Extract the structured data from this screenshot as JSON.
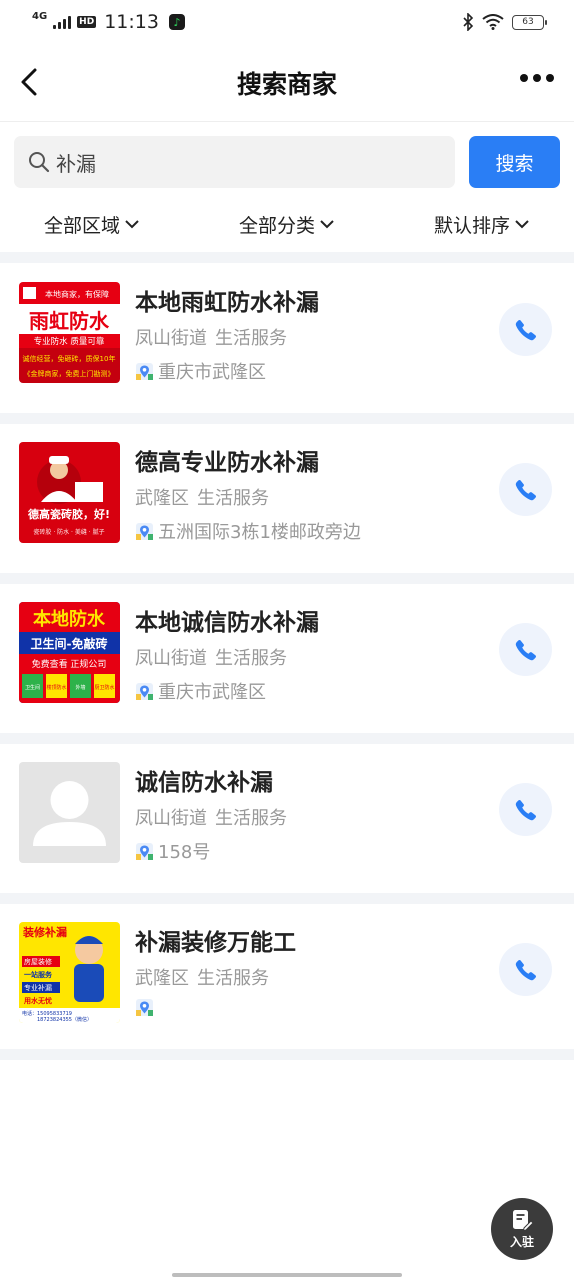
{
  "status_bar": {
    "network": "4G",
    "hd": "HD",
    "time": "11:13",
    "battery": "63"
  },
  "nav": {
    "title": "搜索商家",
    "back_icon": "back-arrow-icon",
    "more_icon": "more-dots-icon"
  },
  "search": {
    "query": "补漏",
    "button_label": "搜索"
  },
  "filters": [
    {
      "label": "全部区域"
    },
    {
      "label": "全部分类"
    },
    {
      "label": "默认排序"
    }
  ],
  "merchants": [
    {
      "name": "本地雨虹防水补漏",
      "area": "凤山街道",
      "category": "生活服务",
      "address": "重庆市武隆区",
      "thumb": {
        "line1": "本地商家，有保障",
        "title": "雨虹防水",
        "line2": "专业防水 质量可靠",
        "line3": "诚信经营，免砸砖，质保10年",
        "line4": "《金牌商家，免费上门勘测》"
      }
    },
    {
      "name": "德高专业防水补漏",
      "area": "武隆区",
      "category": "生活服务",
      "address": "五洲国际3栋1楼邮政旁边",
      "thumb": {
        "title": "德高瓷砖胶，好!",
        "line1": "瓷砖胶 · 防水 · 美缝 · 腻子"
      }
    },
    {
      "name": "本地诚信防水补漏",
      "area": "凤山街道",
      "category": "生活服务",
      "address": "重庆市武隆区",
      "thumb": {
        "title": "本地防水",
        "line1": "卫生间-免敲砖",
        "line2": "免费查看  正规公司",
        "tags": [
          "卫生间",
          "楼顶防水",
          "外墙",
          "厨卫防水"
        ]
      }
    },
    {
      "name": "诚信防水补漏",
      "area": "凤山街道",
      "category": "生活服务",
      "address": "158号",
      "thumb": null
    },
    {
      "name": "补漏装修万能工",
      "area": "武隆区",
      "category": "生活服务",
      "address": "",
      "thumb": {
        "title": "装修补漏",
        "line1": "房屋装修",
        "line2": "一站服务",
        "line3": "专业补漏",
        "line4": "用水无忧",
        "phone1": "电话：15095833719",
        "phone2": "18723824355（微信）"
      }
    }
  ],
  "fab": {
    "label": "入驻"
  },
  "colors": {
    "accent": "#2a7ef5",
    "call_bg": "#eef3fc",
    "separator": "#f2f4f7"
  }
}
